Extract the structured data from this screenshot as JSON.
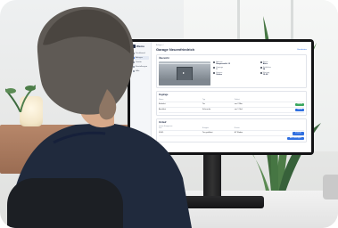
{
  "app": {
    "brand": "Wemu"
  },
  "sidebar": {
    "items": [
      {
        "label": "Dashboard",
        "active": false
      },
      {
        "label": "Anlagen",
        "active": true
      },
      {
        "label": "Geräte",
        "active": false
      },
      {
        "label": "Einstellungen",
        "active": false
      },
      {
        "label": "Hilfe",
        "active": false
      }
    ],
    "footer": "Online"
  },
  "header": {
    "breadcrumb": "Anlagen /",
    "title": "Garage Neuenfriedrich",
    "link": "Bearbeiten"
  },
  "overview": {
    "title": "Übersicht",
    "info": [
      {
        "label": "Adresse",
        "value": "Hauptstraße 12"
      },
      {
        "label": "Status",
        "value": "Aktiv"
      },
      {
        "label": "Zugänge",
        "value": "3"
      },
      {
        "label": "Stellplätze",
        "value": "24"
      },
      {
        "label": "Kamera",
        "value": "Online"
      },
      {
        "label": "Wartung",
        "value": "12.05."
      }
    ]
  },
  "access": {
    "title": "Zugänge",
    "columns": [
      "Name",
      "Typ",
      "Zuletzt",
      ""
    ],
    "rows": [
      {
        "name": "Einfahrt",
        "type": "Tor",
        "last": "vor 2 Min.",
        "action": "Öffnen"
      },
      {
        "name": "Ausfahrt",
        "type": "Schranke",
        "last": "vor 1 Std.",
        "action": "Öffnen"
      }
    ]
  },
  "history": {
    "title": "Verlauf",
    "subtitle": "Letzte Ereignisse",
    "columns": [
      "Zeit",
      "Ereignis",
      "Nutzer",
      ""
    ],
    "rows": [
      {
        "time": "09:41",
        "event": "Tor geöffnet",
        "user": "M. Weber",
        "action": "Details"
      }
    ],
    "button": "Alle anzeigen"
  },
  "colors": {
    "accent": "#2f6fe0",
    "success": "#3aa760",
    "sidebar_bg": "#f4f6f9",
    "text_dark": "#1f2a44"
  },
  "icons": {
    "play": "play-icon",
    "info": "info-dot-icon"
  }
}
